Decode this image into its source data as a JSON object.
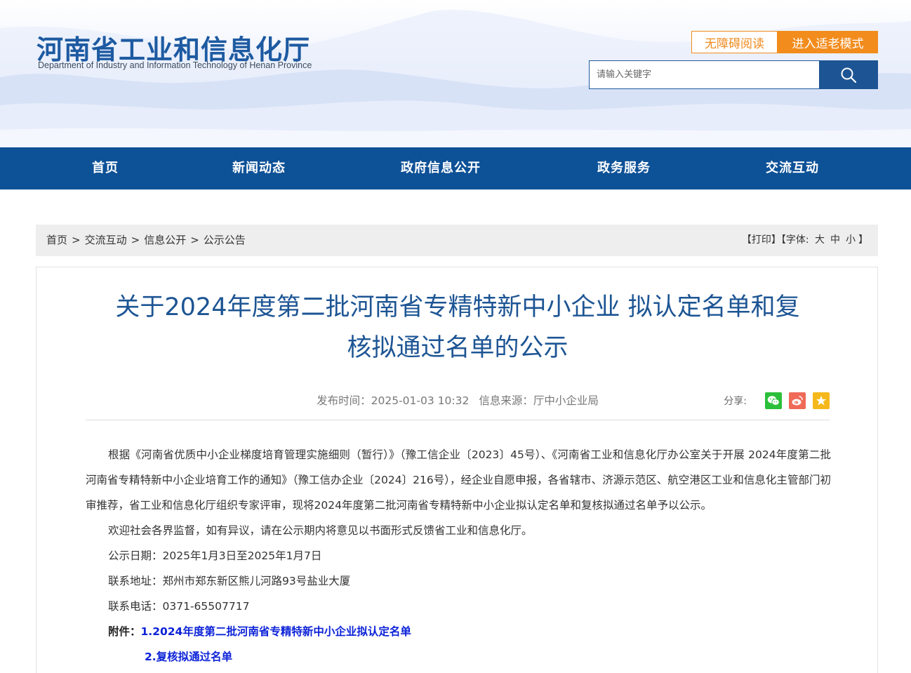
{
  "header": {
    "site_title": "河南省工业和信息化厅",
    "site_subtitle": "Department of Industry and Information Technology of Henan Province",
    "accessible_label": "无障碍阅读",
    "elder_mode_label": "进入适老模式",
    "search_placeholder": "请输入关键字",
    "search_icon": "search-icon"
  },
  "nav": {
    "items": [
      {
        "label": "首页"
      },
      {
        "label": "新闻动态"
      },
      {
        "label": "政府信息公开"
      },
      {
        "label": "政务服务"
      },
      {
        "label": "交流互动"
      }
    ]
  },
  "breadcrumb": {
    "items": [
      "首页",
      "交流互动",
      "信息公开",
      "公示公告"
    ],
    "separator": ">"
  },
  "tools": {
    "print": "【打印】",
    "font_prefix": "【字体:",
    "font_large": "大",
    "font_medium": "中",
    "font_small": "小",
    "font_suffix": "】"
  },
  "article": {
    "title_line1": "关于2024年度第二批河南省专精特新中小企业 拟认定名单和复",
    "title_line2": "核拟通过名单的公示",
    "publish_time": "发布时间：2025-01-03 10:32",
    "source": "信息来源：厅中小企业局",
    "share_label": "分享:",
    "share_icons": [
      "wechat-icon",
      "weibo-icon",
      "qzone-icon"
    ],
    "colors": {
      "wechat": "#2bbf3a",
      "weibo": "#f06a58",
      "qzone": "#f5b81c"
    },
    "para1": "根据《河南省优质中小企业梯度培育管理实施细则（暂行）》（豫工信企业〔2023〕45号）、《河南省工业和信息化厅办公室关于开展 2024年度第二批河南省专精特新中小企业培育工作的通知》（豫工信办企业〔2024〕216号），经企业自愿申报，各省辖市、济源示范区、航空港区工业和信息化主管部门初审推荐，省工业和信息化厅组织专家评审，现将2024年度第二批河南省专精特新中小企业拟认定名单和复核拟通过名单予以公示。",
    "para2": "欢迎社会各界监督，如有异议，请在公示期内将意见以书面形式反馈省工业和信息化厅。",
    "date_line": "公示日期：2025年1月3日至2025年1月7日",
    "address_line": "联系地址：郑州市郑东新区熊儿河路93号盐业大厦",
    "phone_line": "联系电话：0371-65507717",
    "attach_label": "附件：",
    "attach1": "1.2024年度第二批河南省专精特新中小企业拟认定名单",
    "attach2": "2.复核拟通过名单"
  }
}
